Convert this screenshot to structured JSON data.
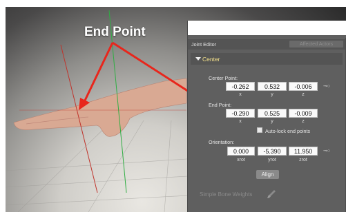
{
  "annotation": {
    "title": "End Point"
  },
  "panel": {
    "title": "Joint Editor",
    "affected_actors_button": "Affected Actors",
    "section": "Center",
    "center_point": {
      "label": "Center Point:",
      "values": [
        "-0.262",
        "0.532",
        "-0.006"
      ],
      "axes": [
        "x",
        "y",
        "z"
      ]
    },
    "end_point": {
      "label": "End Point:",
      "values": [
        "-0.290",
        "0.525",
        "-0.009"
      ],
      "axes": [
        "x",
        "y",
        "z"
      ]
    },
    "auto_lock_label": "Auto-lock end points",
    "orientation": {
      "label": "Orientation:",
      "values": [
        "0.000",
        "-5.390",
        "11.950"
      ],
      "axes": [
        "xrot",
        "yrot",
        "zrot"
      ]
    },
    "align_button": "Align",
    "simple_bone_weights": "Simple Bone Weights"
  },
  "colors": {
    "arrow": "#e8261c",
    "x_axis": "#c0342c",
    "y_axis": "#2fae43",
    "highlight": "#f3e08a"
  }
}
